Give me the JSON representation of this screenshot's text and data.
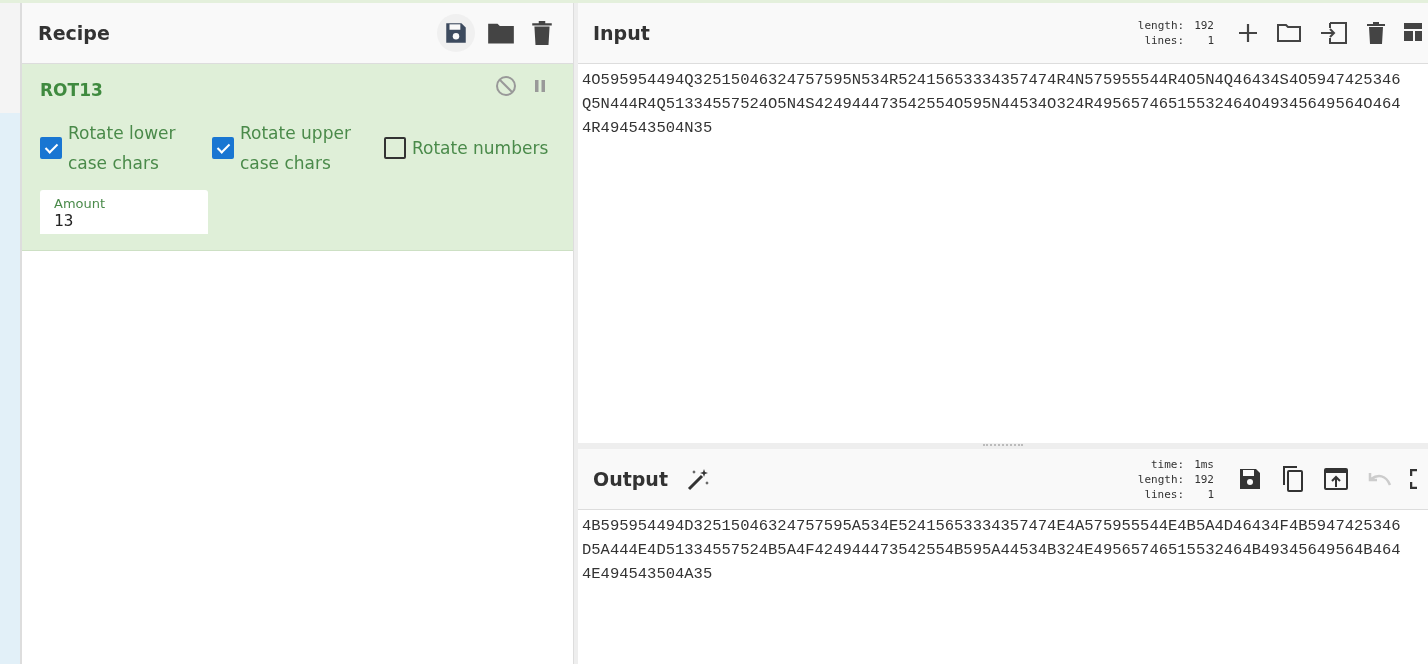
{
  "recipe": {
    "title": "Recipe",
    "operations": [
      {
        "name": "ROT13",
        "args": [
          {
            "kind": "checkbox",
            "label": "Rotate lower case chars",
            "checked": true
          },
          {
            "kind": "checkbox",
            "label": "Rotate upper case chars",
            "checked": true
          },
          {
            "kind": "checkbox",
            "label": "Rotate numbers",
            "checked": false
          },
          {
            "kind": "number",
            "label": "Amount",
            "value": "13"
          }
        ]
      }
    ]
  },
  "input": {
    "title": "Input",
    "stats": [
      {
        "label": "length:",
        "value": "192"
      },
      {
        "label": "lines:",
        "value": "1"
      }
    ],
    "lines": [
      "4O595954494Q32515046324757595N534R52415653334357474R4N575955544R4O5N4Q46434S4O5947425346",
      "Q5N444R4Q51334557524O5N4S424944473542554O595N44534O324R49565746515532464O49345649564O464",
      "4R494543504N35"
    ]
  },
  "output": {
    "title": "Output",
    "stats": [
      {
        "label": "time:",
        "value": "1ms"
      },
      {
        "label": "length:",
        "value": "192"
      },
      {
        "label": "lines:",
        "value": "1"
      }
    ],
    "lines": [
      "4B595954494D32515046324757595A534E52415653334357474E4A575955544E4B5A4D46434F4B5947425346",
      "D5A444E4D51334557524B5A4F424944473542554B595A44534B324E49565746515532464B49345649564B464",
      "4E494543504A35"
    ]
  }
}
